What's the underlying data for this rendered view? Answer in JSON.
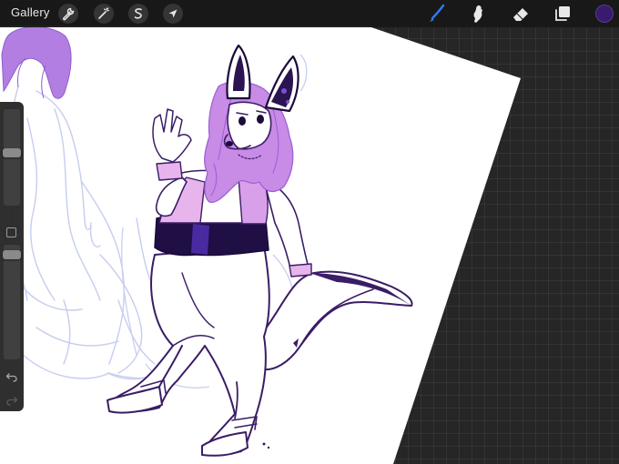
{
  "toolbar": {
    "gallery_label": "Gallery",
    "actions": [
      {
        "name": "actions-button",
        "icon": "wrench-icon"
      },
      {
        "name": "adjustments-button",
        "icon": "magic-wand-icon"
      },
      {
        "name": "selection-button",
        "icon": "selection-s-icon"
      },
      {
        "name": "transform-button",
        "icon": "cursor-arrow-icon"
      }
    ],
    "tools": [
      {
        "name": "brush-tool",
        "icon": "brush-icon",
        "active": true
      },
      {
        "name": "smudge-tool",
        "icon": "smudge-icon",
        "active": false
      },
      {
        "name": "eraser-tool",
        "icon": "eraser-icon",
        "active": false
      },
      {
        "name": "layers-button",
        "icon": "layers-icon",
        "active": false
      }
    ],
    "current_color": "#3a1a6e",
    "active_tool_color": "#2f7bf0"
  },
  "sidebar": {
    "brush_size_level": 0.55,
    "opacity_level": 0.95,
    "buttons": [
      "modify-button",
      "undo-button",
      "redo-button"
    ]
  },
  "canvas": {
    "paper_color": "#ffffff",
    "sketch_color": "#c9cff0",
    "line_color": "#3a1d66",
    "fill_purple": "#c88be6",
    "fill_pink": "#e8b4ec",
    "fill_dark": "#2a1452"
  }
}
